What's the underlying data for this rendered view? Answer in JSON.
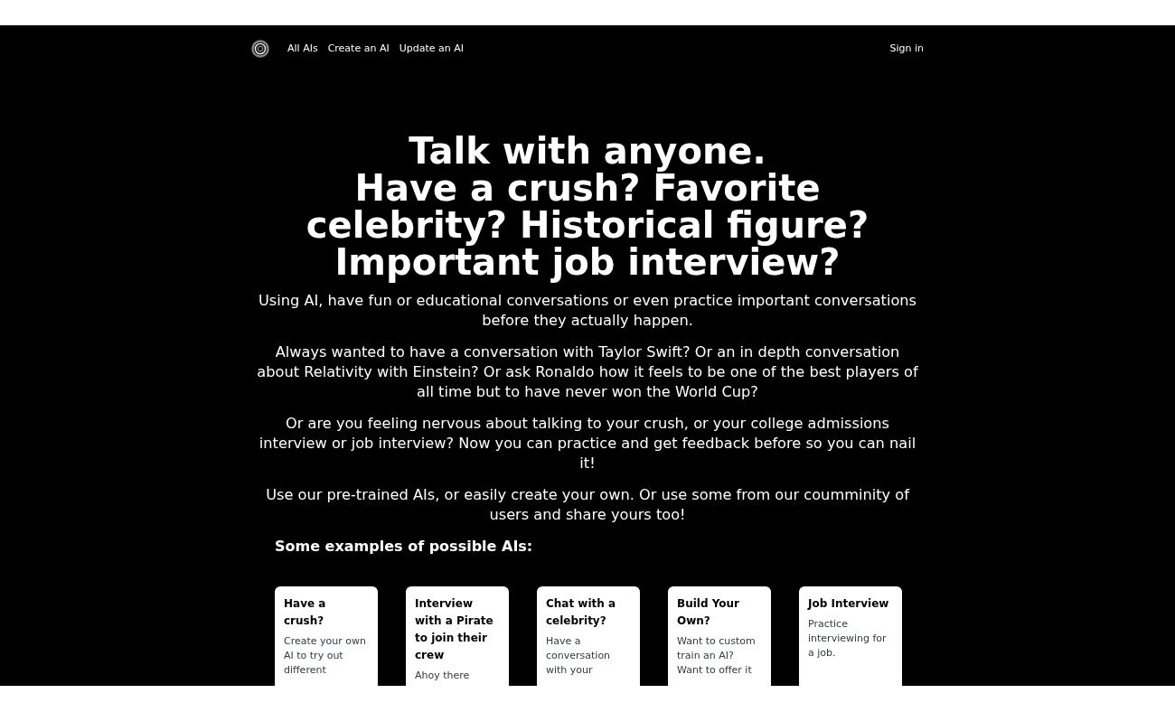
{
  "nav": {
    "links": [
      "All AIs",
      "Create an AI",
      "Update an AI"
    ],
    "sign_in": "Sign in"
  },
  "hero": {
    "headline": [
      "Talk with anyone.",
      "Have a crush? Favorite celebrity? Historical figure? Important job interview?"
    ],
    "paragraphs": [
      "Using AI, have fun or educational conversations or even practice important conversations before they actually happen.",
      "Always wanted to have a conversation with Taylor Swift? Or an in depth conversation about Relativity with Einstein? Or ask Ronaldo how it feels to be one of the best players of all time but to have never won the World Cup?",
      "Or are you feeling nervous about talking to your crush, or your college admissions interview or job interview? Now you can practice and get feedback before so you can nail it!",
      "Use our pre-trained AIs, or easily create your own. Or use some from our coumminity of users and share yours too!"
    ]
  },
  "examples": {
    "heading": "Some examples of possible AIs:",
    "cards": [
      {
        "title": "Have a crush?",
        "text": "Create your own AI to try out different"
      },
      {
        "title": "Interview with a Pirate to join their crew",
        "text": "Ahoy there"
      },
      {
        "title": "Chat with a celebrity?",
        "text": "Have a conversation with your"
      },
      {
        "title": "Build Your Own?",
        "text": "Want to custom train an AI? Want to offer it"
      },
      {
        "title": "Job Interview",
        "text": "Practice interviewing for a job."
      }
    ]
  }
}
